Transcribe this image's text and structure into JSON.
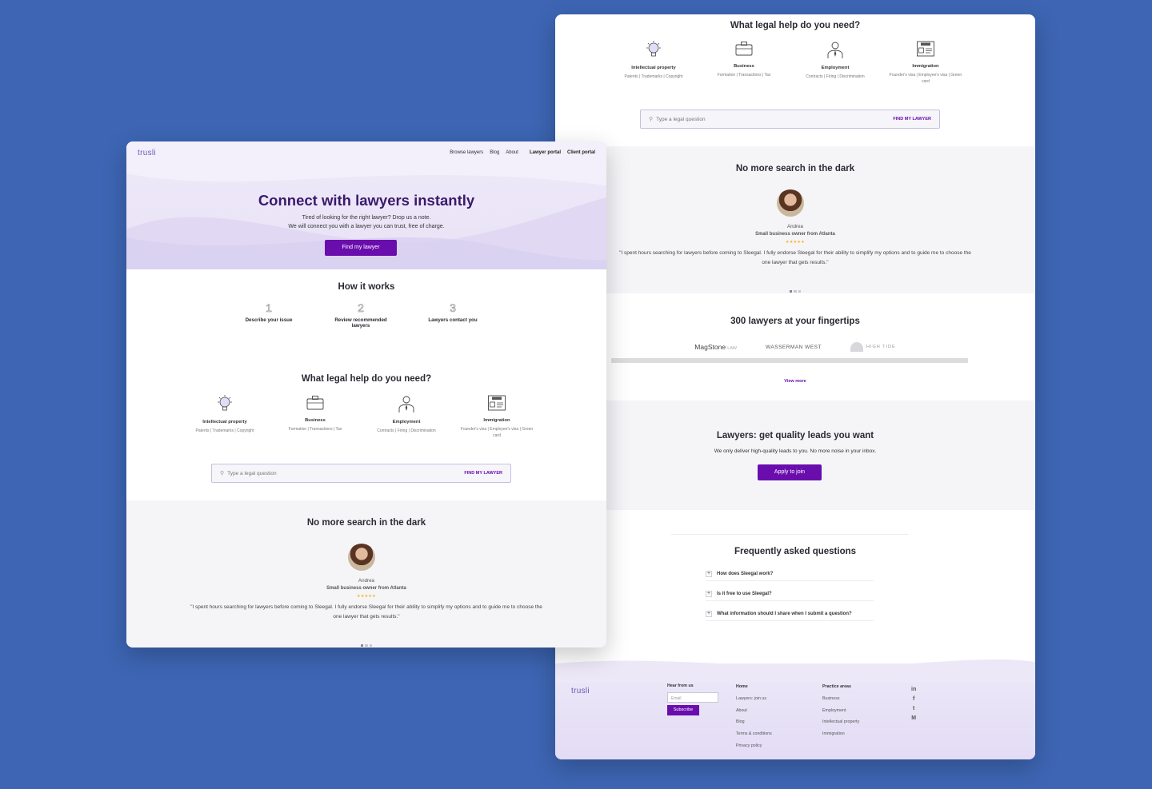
{
  "nav": {
    "logo": "trusli",
    "links": [
      "Browse lawyers",
      "Blog",
      "About"
    ],
    "lawyer_portal": "Lawyer portal",
    "client_portal": "Client portal"
  },
  "hero": {
    "title": "Connect with lawyers instantly",
    "line1": "Tired of looking for the right lawyer? Drop us a note.",
    "line2": "We will connect you with a lawyer you can trust, free of charge.",
    "button": "Find my lawyer"
  },
  "how": {
    "title": "How it works",
    "steps": [
      {
        "num": "1",
        "label": "Describe your issue"
      },
      {
        "num": "2",
        "label": "Review recommended lawyers"
      },
      {
        "num": "3",
        "label": "Lawyers contact you"
      }
    ]
  },
  "legal": {
    "title": "What legal help do you need?",
    "categories": [
      {
        "title": "Intellectual property",
        "sub": "Patents | Trademarks | Copyright",
        "icon": "lightbulb-icon"
      },
      {
        "title": "Business",
        "sub": "Formation | Transactions | Tax",
        "icon": "briefcase-icon"
      },
      {
        "title": "Employment",
        "sub": "Contracts | Firing | Discrimination",
        "icon": "employee-icon"
      },
      {
        "title": "Immigration",
        "sub": "Founder's visa | Employee's visa | Green card",
        "icon": "visa-icon"
      }
    ],
    "search_placeholder": "Type a legal question",
    "search_button": "FIND MY LAWYER"
  },
  "testimonial": {
    "title": "No more search in the dark",
    "name": "Andrea",
    "role": "Small business owner from Atlanta",
    "stars": "★★★★★",
    "quote": "\"I spent hours searching for lawyers before coming to Sleegal. I fully endorse Sleegal for their ability to simplify my options and to guide me to choose the one lawyer that gets results.\""
  },
  "lawyers": {
    "title": "300 lawyers at your fingertips",
    "logos": [
      "MagStone",
      "LAW",
      "WASSERMAN WEST",
      "HIGH TIDE"
    ],
    "view_more": "View more"
  },
  "leads": {
    "title": "Lawyers: get quality leads you want",
    "subtitle": "We only deliver high-quality leads to you. No more noise in your inbox.",
    "button": "Apply to join"
  },
  "faq": {
    "title": "Frequently asked questions",
    "items": [
      "How does Sleegal work?",
      "Is it free to use Sleegal?",
      "What information should I share when I submit a question?"
    ]
  },
  "footer": {
    "logo": "trusli",
    "hear_title": "Hear from us",
    "email_placeholder": "Email",
    "subscribe": "Subscribe",
    "home_title": "Home",
    "home_links": [
      "Lawyers: join us",
      "About",
      "Blog",
      "Terms & conditions",
      "Privacy policy"
    ],
    "practice_title": "Practice areas",
    "practice_links": [
      "Business",
      "Employment",
      "Intellectual property",
      "Immigration"
    ],
    "social": [
      "in",
      "f",
      "t",
      "M"
    ]
  },
  "colors": {
    "accent": "#6a0dad",
    "background": "#3d65b3",
    "hero_title": "#3a1a6b"
  }
}
